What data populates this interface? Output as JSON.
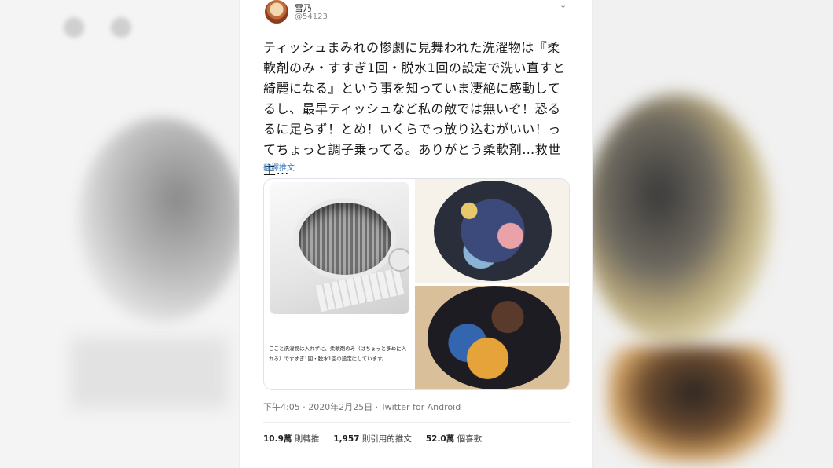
{
  "tweet": {
    "display_name": "雪乃",
    "handle": "@54123",
    "body": "ティッシュまみれの惨劇に見舞われた洗濯物は『柔軟剤のみ・すすぎ1回・脱水1回の設定で洗い直すと綺麗になる』という事を知っていま凄絶に感動してるし、最早ティッシュなど私の敵では無いぞ！恐るるに足らず！とめ！いくらでっ放り込むがいい！ってちょっと調子乗ってる。ありがとう柔軟剤…救世主…",
    "translate_label": "翻譯推文",
    "media_caption": "ここと洗濯物は入れずに、柔軟剤のみ（はちょっと多めに入れる）ですすぎ1回・脱水1回の設定にしています。",
    "timestamp": "下午4:05 · 2020年2月25日 · Twitter for Android",
    "stats": {
      "retweets": "10.9萬",
      "retweets_label": "則轉推",
      "quotes": "1,957",
      "quotes_label": "則引用的推文",
      "likes": "52.0萬",
      "likes_label": "個喜歡"
    }
  },
  "icons": [
    "avatar",
    "chevron-down-icon"
  ]
}
